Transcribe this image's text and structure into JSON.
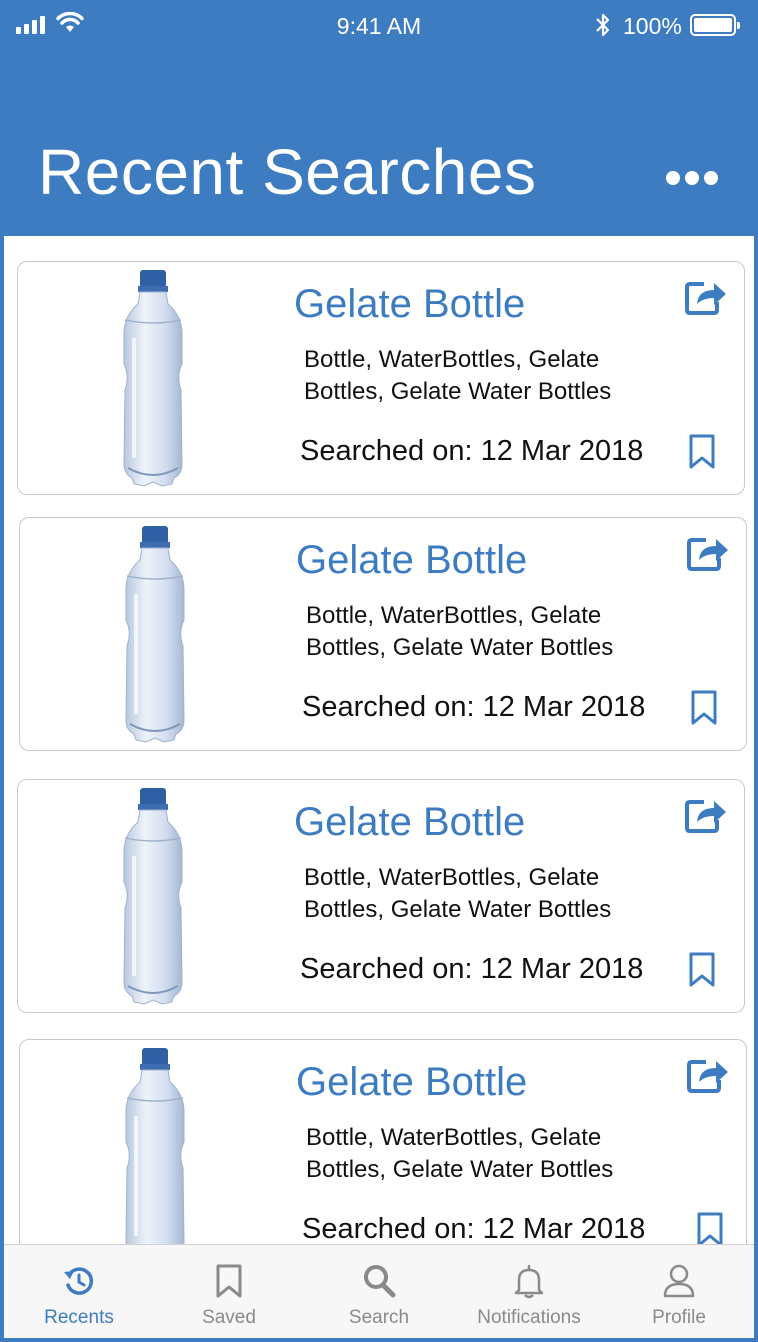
{
  "status_bar": {
    "time": "9:41 AM",
    "battery": "100%"
  },
  "header": {
    "title": "Recent Searches",
    "menu_icon": "more-horizontal-icon"
  },
  "results": [
    {
      "title": "Gelate Bottle",
      "tags": "Bottle, WaterBottles, Gelate Bottles, Gelate Water Bottles",
      "searched_on": "Searched on: 12 Mar 2018"
    },
    {
      "title": "Gelate Bottle",
      "tags": "Bottle, WaterBottles, Gelate Bottles, Gelate Water Bottles",
      "searched_on": "Searched on: 12 Mar 2018"
    },
    {
      "title": "Gelate Bottle",
      "tags": "Bottle, WaterBottles, Gelate Bottles, Gelate Water Bottles",
      "searched_on": "Searched on: 12 Mar 2018"
    },
    {
      "title": "Gelate Bottle",
      "tags": "Bottle, WaterBottles, Gelate Bottles, Gelate Water Bottles",
      "searched_on": "Searched on: 12 Mar 2018"
    }
  ],
  "tabs": [
    {
      "label": "Recents",
      "icon": "history-icon",
      "active": true
    },
    {
      "label": "Saved",
      "icon": "bookmark-icon",
      "active": false
    },
    {
      "label": "Search",
      "icon": "search-icon",
      "active": false
    },
    {
      "label": "Notifications",
      "icon": "bell-icon",
      "active": false
    },
    {
      "label": "Profile",
      "icon": "user-icon",
      "active": false
    }
  ],
  "colors": {
    "accent": "#3e7cc1",
    "inactive": "#8a8a8a",
    "text": "#111111"
  }
}
